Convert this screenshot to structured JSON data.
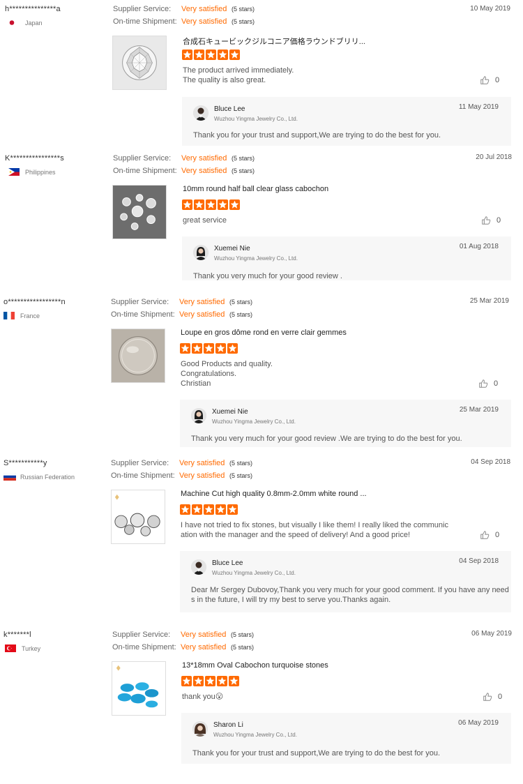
{
  "colors": {
    "accent": "#ff6a00",
    "reply_bg": "#f7f7f7"
  },
  "labels": {
    "supplier_service": "Supplier Service:",
    "on_time_shipment": "On-time Shipment:"
  },
  "reviews": [
    {
      "buyer": "h***************a",
      "country": "Japan",
      "flag": "japan-flag-icon",
      "date": "10 May 2019",
      "supplier_service": "Very satisfied",
      "supplier_stars": "(5 stars)",
      "shipment": "Very satisfied",
      "shipment_stars": "(5 stars)",
      "product_title": "合成石キュービックジルコニア価格ラウンドブリリ...",
      "rating": 5,
      "text": "The product arrived immediately.\nThe quality is also great.",
      "likes": "0",
      "thumb": "round-diamond-image",
      "reply": {
        "name": "Bluce Lee",
        "company": "Wuzhou Yingma Jewelry Co., Ltd.",
        "date": "11 May 2019",
        "text": "Thank you for your trust and support,We are trying to do the best for you."
      }
    },
    {
      "buyer": "K****************s",
      "country": "Philippines",
      "flag": "philippines-flag-icon",
      "date": "20 Jul 2018",
      "supplier_service": "Very satisfied",
      "supplier_stars": "(5 stars)",
      "shipment": "Very satisfied",
      "shipment_stars": "(5 stars)",
      "product_title": "10mm round half ball clear glass cabochon",
      "rating": 5,
      "text": "great service",
      "likes": "0",
      "thumb": "glass-cabochons-image",
      "reply": {
        "name": "Xuemei Nie",
        "company": "Wuzhou Yingma Jewelry Co., Ltd.",
        "date": "01 Aug 2018",
        "text": "Thank you very much for your good review ."
      }
    },
    {
      "buyer": "o*****************n",
      "country": "France",
      "flag": "france-flag-icon",
      "date": "25 Mar 2019",
      "supplier_service": "Very satisfied",
      "supplier_stars": "(5 stars)",
      "shipment": "Very satisfied",
      "shipment_stars": "(5 stars)",
      "product_title": "Loupe en gros dôme rond en verre clair gemmes",
      "rating": 5,
      "text": "Good Products and quality.\nCongratulations.\nChristian",
      "likes": "0",
      "thumb": "glass-dome-image",
      "reply": {
        "name": "Xuemei Nie",
        "company": "Wuzhou Yingma Jewelry Co., Ltd.",
        "date": "25 Mar 2019",
        "text": "Thank you very much for your good review .We are trying to do the best for you."
      }
    },
    {
      "buyer": "S***********y",
      "country": "Russian Federation",
      "flag": "russia-flag-icon",
      "date": "04 Sep 2018",
      "supplier_service": "Very satisfied",
      "supplier_stars": "(5 stars)",
      "shipment": "Very satisfied",
      "shipment_stars": "(5 stars)",
      "product_title": "Machine Cut high quality 0.8mm-2.0mm white round ...",
      "rating": 5,
      "text": "I have not tried to fix stones, but visually I like them! I really liked the communic\nation with the manager and the speed of delivery! And a good price!",
      "likes": "0",
      "thumb": "cut-stones-image",
      "reply": {
        "name": "Bluce Lee",
        "company": "Wuzhou Yingma Jewelry Co., Ltd.",
        "date": "04 Sep 2018",
        "text": "Dear Mr Sergey Dubovoy,Thank you very much for your good comment. If you have any need\ns in the future, I will try my best to serve you.Thanks again."
      }
    },
    {
      "buyer": "k*******l",
      "country": "Turkey",
      "flag": "turkey-flag-icon",
      "date": "06 May 2019",
      "supplier_service": "Very satisfied",
      "supplier_stars": "(5 stars)",
      "shipment": "Very satisfied",
      "shipment_stars": "(5 stars)",
      "product_title": "13*18mm Oval Cabochon turquoise stones",
      "rating": 5,
      "text": "thank you😮",
      "likes": "0",
      "thumb": "turquoise-stones-image",
      "reply": {
        "name": "Sharon Li",
        "company": "Wuzhou Yingma Jewelry Co., Ltd.",
        "date": "06 May 2019",
        "text": "Thank you for your trust and support,We are trying to do the best for you."
      }
    }
  ]
}
